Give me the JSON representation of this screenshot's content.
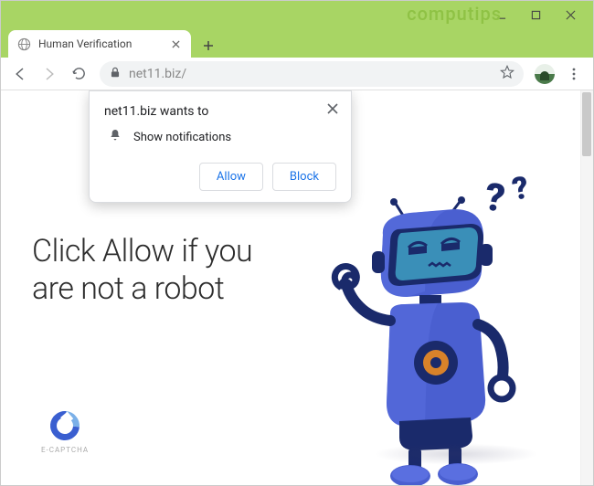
{
  "window": {
    "watermark": "computips"
  },
  "tab": {
    "title": "Human Verification"
  },
  "address": {
    "url": "net11.biz/"
  },
  "permission": {
    "title_text": "net11.biz wants to",
    "item_label": "Show notifications",
    "allow": "Allow",
    "block": "Block"
  },
  "page": {
    "headline": "Click Allow if you are not a robot",
    "badge": "E-CAPTCHA"
  }
}
